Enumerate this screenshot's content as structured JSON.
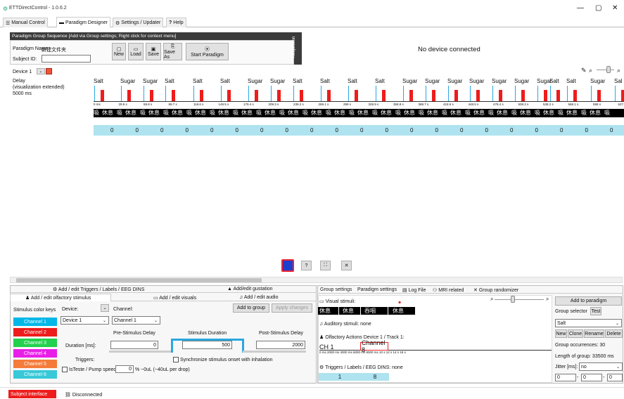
{
  "title": "ETTDirectControl - 1.0.6.2",
  "window_controls": [
    "—",
    "▢",
    "✕"
  ],
  "tabs": [
    {
      "label": "Manual Control",
      "icon": "☰"
    },
    {
      "label": "Paradigm Designer",
      "icon": "▬"
    },
    {
      "label": "Settings / Updater",
      "icon": "⚙"
    },
    {
      "label": "Help",
      "icon": "?"
    }
  ],
  "paradigm": {
    "header": "Paradigm Group Sequence [Add via Group settings; Right click for context menu]",
    "name_label": "Paradigm Name:",
    "name_value": "新建文件夹",
    "subject_label": "Subject ID:",
    "subject_value": "",
    "buttons": [
      "New",
      "Load",
      "Save",
      "Save As",
      "Start Paradigm"
    ],
    "respiration": "Respiration",
    "no_device": "No device connected"
  },
  "device": {
    "label": "Device 1",
    "delay": "Delay",
    "vis": "(visualization extended)",
    "ms": "5000 ms"
  },
  "timeline": {
    "labels": [
      "Salt",
      "Sugar",
      "Sugar",
      "Salt",
      "Salt",
      "Salt",
      "Sugar",
      "Sugar",
      "Salt",
      "Salt",
      "Salt",
      "Salt",
      "Sugar",
      "Sugar",
      "Sugar",
      "Sugar",
      "Sugar",
      "Sugar",
      "Sugar",
      "Salt",
      "Salt",
      "Sugar",
      "Sal"
    ],
    "times": [
      "0 ms",
      "29.9 s",
      "59.8 s",
      "89.7 s",
      "119.6 s",
      "149.5 s",
      "179.4 s",
      "209.3 s",
      "239.2 s",
      "269.1 s",
      "299 s",
      "328.9 s",
      "358.8 s",
      "388.7 s",
      "418.6 s",
      "448.5 s",
      "478.4 s",
      "508.3 s",
      "538.2 s",
      "568.1 s",
      "598 s",
      "627.9 s"
    ],
    "rest_cells": [
      "吸",
      "休息",
      "吸",
      "休息",
      "吸",
      "休息",
      "吸",
      "休息",
      "吸",
      "休息",
      "吸",
      "休息",
      "吸",
      "休息",
      "吸",
      "休息",
      "吸",
      "休息",
      "吸",
      "休息",
      "吸",
      "休息",
      "吸",
      "休息",
      "吸",
      "休息",
      "吸",
      "休息",
      "吸",
      "休息",
      "吸",
      "休息",
      "吸",
      "休息",
      "吸",
      "休息",
      "吸",
      "休息",
      "吸",
      "休息",
      "吸",
      "休息",
      "吸",
      "休息",
      "吸"
    ],
    "zeros": [
      "0",
      "0",
      "0",
      "0",
      "0",
      "0",
      "0",
      "0",
      "0",
      "0",
      "0",
      "0",
      "0",
      "0",
      "0",
      "0",
      "0",
      "0",
      "0",
      "0",
      "0"
    ]
  },
  "bottom_tabs": {
    "triggers": "Add / edit Triggers / Labels / EEG DINS",
    "gustation": "Add/edit gustation",
    "olfactory": "Add / edit olfactory stimulus",
    "visuals": "Add / edit visuals",
    "audio": "Add / edit audio"
  },
  "olfactory": {
    "color_keys": "Stimulus color keys",
    "device_label": "Device:",
    "channel_label": "Channel:",
    "device_value": "Device 1",
    "channel_value": "Channel 1",
    "add_group": "Add to group",
    "apply": "Apply changes",
    "channels": [
      {
        "label": "Channel 1",
        "color": "#00b7e8"
      },
      {
        "label": "Channel 2",
        "color": "#ee1c1c"
      },
      {
        "label": "Channel 3",
        "color": "#22d14e"
      },
      {
        "label": "Channel 4",
        "color": "#e81ee8"
      },
      {
        "label": "Channel 5",
        "color": "#f47b3a"
      },
      {
        "label": "Channel 6",
        "color": "#38c8d8"
      }
    ],
    "pre": "Pre-Stimulus Delay",
    "stim": "Stimulus Duration",
    "post": "Post-Stimulus Delay",
    "duration_label": "Duration [ms]:",
    "pre_value": "0",
    "stim_value": "500",
    "post_value": "2000",
    "triggers": "Triggers:",
    "sync": "Synchronize stimulus onset with inhalation",
    "istaste": "IsTeste / Pump speed:",
    "pump_value": "0",
    "pump_desc": "% ~0uL (~40uL per drop)"
  },
  "group": {
    "tabs": [
      "Group settings",
      "Paradigm settings",
      "Log File",
      "MRI related",
      "Group randomizer"
    ],
    "visual": "Visual stimuli:",
    "visual_cells": [
      "休息",
      "休息",
      "吞咽",
      "休息"
    ],
    "auditory": "Auditory stimuli: none",
    "olf_actions": "Olfactory Actions Device 1 / Track 1:",
    "ch_label": "CH 1",
    "channel_box": "Channel 8",
    "ticks": "0 ms  2000 ms  4000 ms  6000 ms  8000 ms  10 s  12 s  14 s  16 s",
    "triggers": "Triggers / Labels / EEG DINS: none",
    "trig_cells": [
      "1",
      "8"
    ],
    "add_para": "Add to paradigm",
    "selector_label": "Group selector",
    "test": "Test",
    "selector_value": "Salt",
    "btns": [
      "New",
      "Clone",
      "Rename",
      "Delete"
    ],
    "occ": "Group occurrences:  30",
    "length": "Length of group:  33500 ms",
    "jitter_label": "Jitter [ms]:",
    "jitter_value": "no",
    "range": [
      "0",
      "0",
      "0"
    ]
  },
  "status": {
    "subject": "Subject interface",
    "disconnected": "Disconnected"
  }
}
